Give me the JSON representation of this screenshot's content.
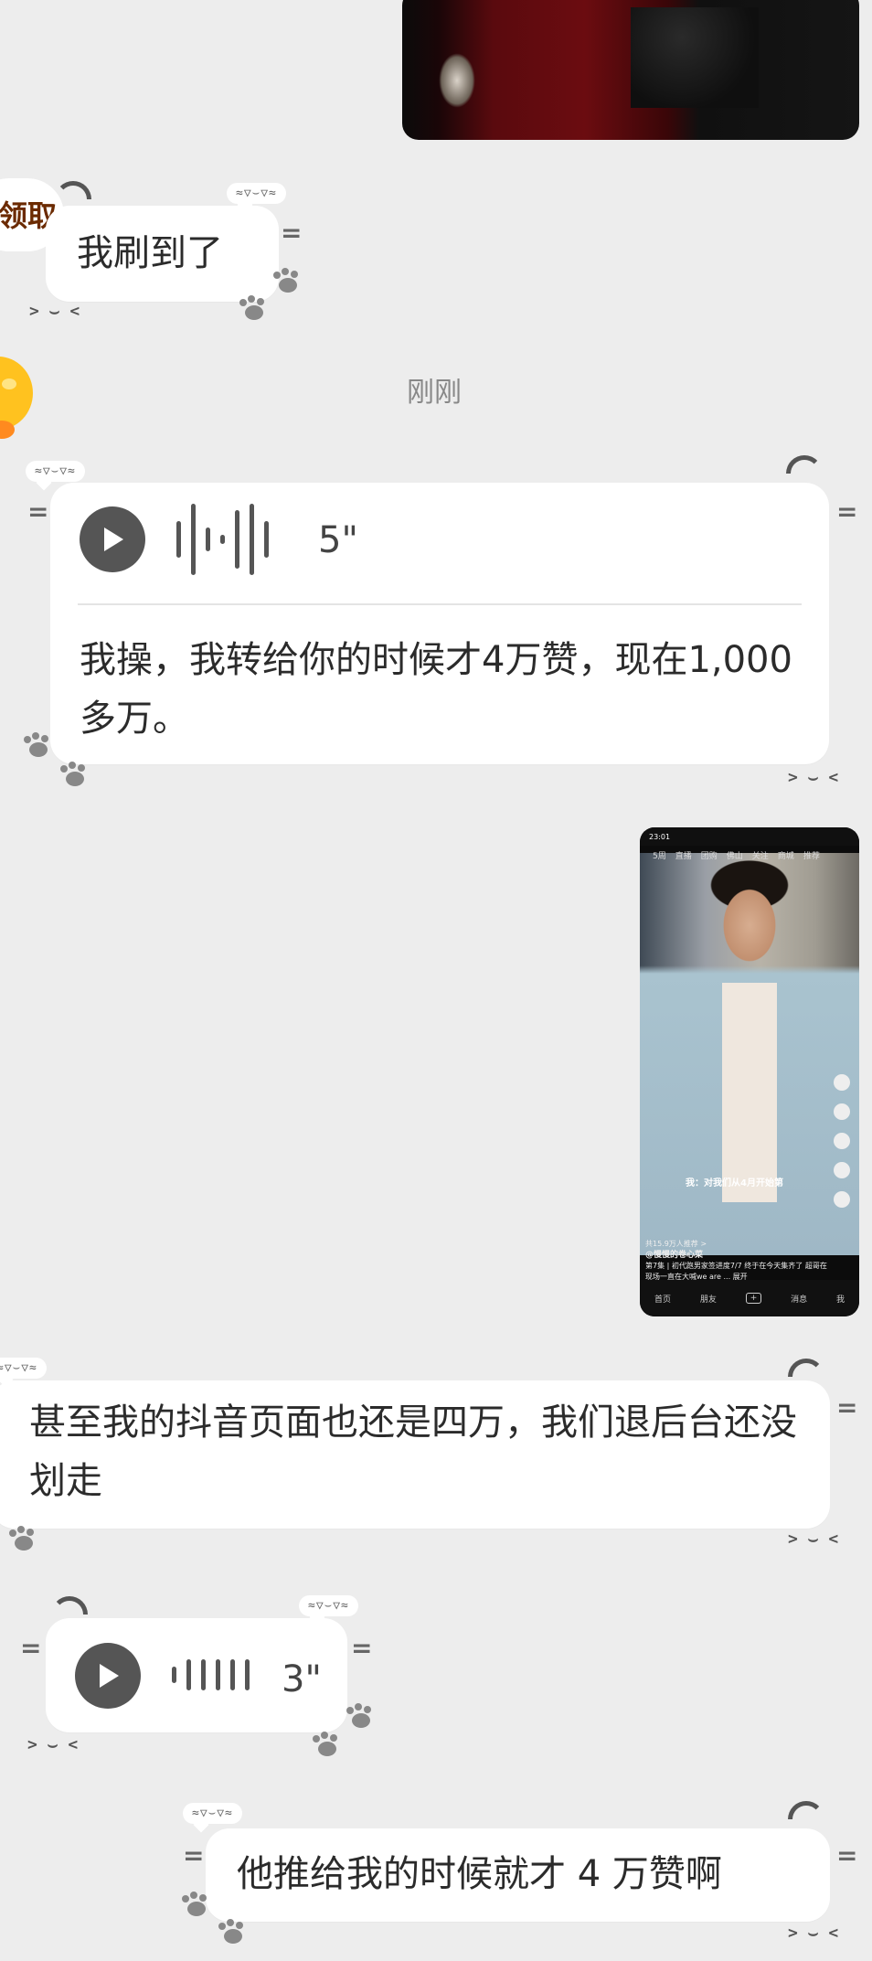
{
  "top_partial_label": "领取",
  "messages": {
    "m1_text": "我刷到了",
    "timestamp": "刚刚",
    "voice1_duration": "5\"",
    "voice1_transcript": "我操，我转给你的时候才4万赞，现在1,000多万。",
    "m3_text": "甚至我的抖音页面也还是四万，我们退后台还没划走",
    "voice2_duration": "3\"",
    "m5_text": "他推给我的时候就才 4 万赞啊"
  },
  "decor": {
    "face_badge": "≈▽⌣▽≈",
    "mouth": "> ⌣ <"
  },
  "phone_screenshot": {
    "time": "23:01",
    "tabs": [
      "5周",
      "直播",
      "团购",
      "佛山",
      "关注",
      "商城",
      "推荐"
    ],
    "caption": "我：对我们从4月开始第",
    "recommend_row": "共15.9万人推荐 >",
    "author": "@慢慢的卷心菜",
    "desc": "第7集 | 初代跑男家签进度7/7 终于在今天集齐了 超哥在现场一直在大喊we are ... 展开",
    "nav": [
      "首页",
      "朋友",
      "+",
      "消息",
      "我"
    ]
  },
  "colors": {
    "background": "#ededed",
    "bubble": "#ffffff",
    "icon": "#555555"
  }
}
